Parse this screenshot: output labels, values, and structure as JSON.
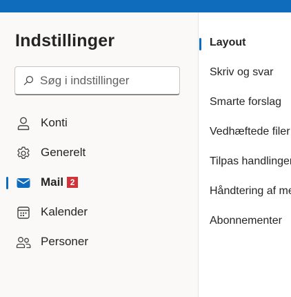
{
  "settings": {
    "title": "Indstillinger",
    "search_placeholder": "Søg i indstillinger",
    "nav": [
      {
        "label": "Konti",
        "icon": "person-icon"
      },
      {
        "label": "Generelt",
        "icon": "gear-icon"
      },
      {
        "label": "Mail",
        "icon": "mail-icon",
        "selected": true,
        "badge": "2"
      },
      {
        "label": "Kalender",
        "icon": "calendar-icon"
      },
      {
        "label": "Personer",
        "icon": "people-icon"
      }
    ],
    "subnav": [
      {
        "label": "Layout",
        "selected": true
      },
      {
        "label": "Skriv og svar"
      },
      {
        "label": "Smarte forslag"
      },
      {
        "label": "Vedhæftede filer"
      },
      {
        "label": "Tilpas handlinger"
      },
      {
        "label": "Håndtering af meddelelser"
      },
      {
        "label": "Abonnementer"
      }
    ]
  },
  "colors": {
    "accent": "#0f6cbd",
    "badge": "#d13438",
    "background": "#faf9f8"
  }
}
